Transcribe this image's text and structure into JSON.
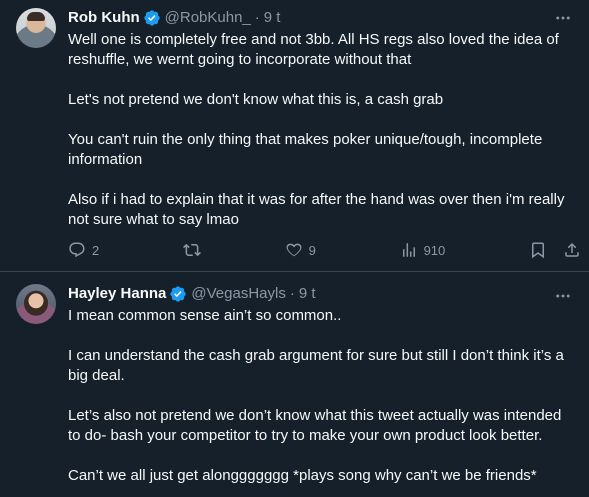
{
  "tweets": [
    {
      "name": "Rob Kuhn",
      "handle": "@RobKuhn_",
      "dot": "·",
      "time": "9 t",
      "paragraphs": [
        "Well one is completely free and not 3bb. All HS regs also loved the idea of reshuffle, we wernt going to incorporate without that",
        "Let's not pretend we don't know what this is, a cash grab",
        "You can't ruin the only thing that makes poker unique/tough, incomplete information",
        "Also if i had to explain that it was for after the hand was over then i'm really not sure what to say lmao"
      ],
      "replies": "2",
      "likes": "9",
      "views": "910"
    },
    {
      "name": "Hayley Hanna",
      "handle": "@VegasHayls",
      "dot": "·",
      "time": "9 t",
      "paragraphs": [
        "I mean common sense ain’t so common..",
        "I can understand the cash grab argument for sure but still I don’t think it’s a big deal.",
        "Let’s also not pretend we don’t know what this tweet actually was intended to do- bash your competitor to try to make your own product look better.",
        "Can’t we all just get alonggggggg *plays song why can’t we be friends*"
      ]
    }
  ],
  "colors": {
    "background": "#15202b",
    "text": "#f7f9f9",
    "secondary": "#8b98a5",
    "verified": "#1d9bf0",
    "divider": "#38444d"
  },
  "icons": [
    "verified-badge-icon",
    "more-icon",
    "reply-icon",
    "retweet-icon",
    "like-icon",
    "views-icon",
    "bookmark-icon",
    "share-icon"
  ]
}
